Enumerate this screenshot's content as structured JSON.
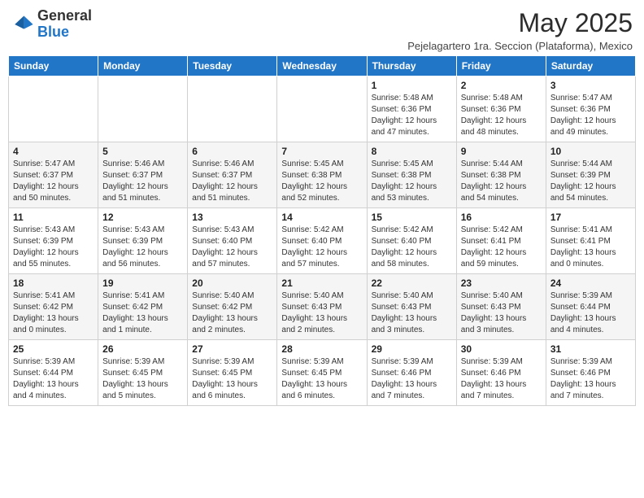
{
  "logo": {
    "general": "General",
    "blue": "Blue"
  },
  "header": {
    "month_year": "May 2025",
    "subtitle": "Pejelagartero 1ra. Seccion (Plataforma), Mexico"
  },
  "days_of_week": [
    "Sunday",
    "Monday",
    "Tuesday",
    "Wednesday",
    "Thursday",
    "Friday",
    "Saturday"
  ],
  "weeks": [
    [
      {
        "day": "",
        "info": ""
      },
      {
        "day": "",
        "info": ""
      },
      {
        "day": "",
        "info": ""
      },
      {
        "day": "",
        "info": ""
      },
      {
        "day": "1",
        "info": "Sunrise: 5:48 AM\nSunset: 6:36 PM\nDaylight: 12 hours and 47 minutes."
      },
      {
        "day": "2",
        "info": "Sunrise: 5:48 AM\nSunset: 6:36 PM\nDaylight: 12 hours and 48 minutes."
      },
      {
        "day": "3",
        "info": "Sunrise: 5:47 AM\nSunset: 6:36 PM\nDaylight: 12 hours and 49 minutes."
      }
    ],
    [
      {
        "day": "4",
        "info": "Sunrise: 5:47 AM\nSunset: 6:37 PM\nDaylight: 12 hours and 50 minutes."
      },
      {
        "day": "5",
        "info": "Sunrise: 5:46 AM\nSunset: 6:37 PM\nDaylight: 12 hours and 51 minutes."
      },
      {
        "day": "6",
        "info": "Sunrise: 5:46 AM\nSunset: 6:37 PM\nDaylight: 12 hours and 51 minutes."
      },
      {
        "day": "7",
        "info": "Sunrise: 5:45 AM\nSunset: 6:38 PM\nDaylight: 12 hours and 52 minutes."
      },
      {
        "day": "8",
        "info": "Sunrise: 5:45 AM\nSunset: 6:38 PM\nDaylight: 12 hours and 53 minutes."
      },
      {
        "day": "9",
        "info": "Sunrise: 5:44 AM\nSunset: 6:38 PM\nDaylight: 12 hours and 54 minutes."
      },
      {
        "day": "10",
        "info": "Sunrise: 5:44 AM\nSunset: 6:39 PM\nDaylight: 12 hours and 54 minutes."
      }
    ],
    [
      {
        "day": "11",
        "info": "Sunrise: 5:43 AM\nSunset: 6:39 PM\nDaylight: 12 hours and 55 minutes."
      },
      {
        "day": "12",
        "info": "Sunrise: 5:43 AM\nSunset: 6:39 PM\nDaylight: 12 hours and 56 minutes."
      },
      {
        "day": "13",
        "info": "Sunrise: 5:43 AM\nSunset: 6:40 PM\nDaylight: 12 hours and 57 minutes."
      },
      {
        "day": "14",
        "info": "Sunrise: 5:42 AM\nSunset: 6:40 PM\nDaylight: 12 hours and 57 minutes."
      },
      {
        "day": "15",
        "info": "Sunrise: 5:42 AM\nSunset: 6:40 PM\nDaylight: 12 hours and 58 minutes."
      },
      {
        "day": "16",
        "info": "Sunrise: 5:42 AM\nSunset: 6:41 PM\nDaylight: 12 hours and 59 minutes."
      },
      {
        "day": "17",
        "info": "Sunrise: 5:41 AM\nSunset: 6:41 PM\nDaylight: 13 hours and 0 minutes."
      }
    ],
    [
      {
        "day": "18",
        "info": "Sunrise: 5:41 AM\nSunset: 6:42 PM\nDaylight: 13 hours and 0 minutes."
      },
      {
        "day": "19",
        "info": "Sunrise: 5:41 AM\nSunset: 6:42 PM\nDaylight: 13 hours and 1 minute."
      },
      {
        "day": "20",
        "info": "Sunrise: 5:40 AM\nSunset: 6:42 PM\nDaylight: 13 hours and 2 minutes."
      },
      {
        "day": "21",
        "info": "Sunrise: 5:40 AM\nSunset: 6:43 PM\nDaylight: 13 hours and 2 minutes."
      },
      {
        "day": "22",
        "info": "Sunrise: 5:40 AM\nSunset: 6:43 PM\nDaylight: 13 hours and 3 minutes."
      },
      {
        "day": "23",
        "info": "Sunrise: 5:40 AM\nSunset: 6:43 PM\nDaylight: 13 hours and 3 minutes."
      },
      {
        "day": "24",
        "info": "Sunrise: 5:39 AM\nSunset: 6:44 PM\nDaylight: 13 hours and 4 minutes."
      }
    ],
    [
      {
        "day": "25",
        "info": "Sunrise: 5:39 AM\nSunset: 6:44 PM\nDaylight: 13 hours and 4 minutes."
      },
      {
        "day": "26",
        "info": "Sunrise: 5:39 AM\nSunset: 6:45 PM\nDaylight: 13 hours and 5 minutes."
      },
      {
        "day": "27",
        "info": "Sunrise: 5:39 AM\nSunset: 6:45 PM\nDaylight: 13 hours and 6 minutes."
      },
      {
        "day": "28",
        "info": "Sunrise: 5:39 AM\nSunset: 6:45 PM\nDaylight: 13 hours and 6 minutes."
      },
      {
        "day": "29",
        "info": "Sunrise: 5:39 AM\nSunset: 6:46 PM\nDaylight: 13 hours and 7 minutes."
      },
      {
        "day": "30",
        "info": "Sunrise: 5:39 AM\nSunset: 6:46 PM\nDaylight: 13 hours and 7 minutes."
      },
      {
        "day": "31",
        "info": "Sunrise: 5:39 AM\nSunset: 6:46 PM\nDaylight: 13 hours and 7 minutes."
      }
    ]
  ]
}
